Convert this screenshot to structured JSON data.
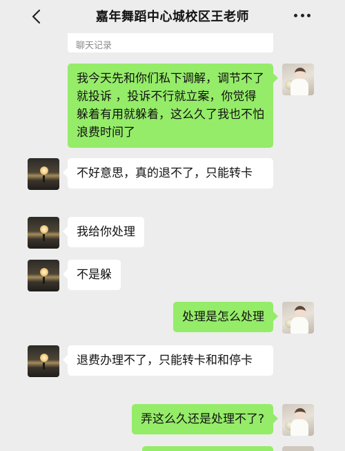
{
  "header": {
    "title": "嘉年舞蹈中心城校区王老师",
    "back_icon": "chevron-left-icon",
    "more_icon": "more-dots-icon"
  },
  "history_label": "聊天记录",
  "messages": [
    {
      "side": "out",
      "text": "我今天先和你们私下调解，调节不了就投诉 ，投诉不行就立案，你觉得躲着有用就躲着，这么久了我也不怕浪费时间了"
    },
    {
      "side": "in",
      "text": "不好意思，真的退不了，只能转卡"
    },
    {
      "side": "in",
      "text": "我给你处理"
    },
    {
      "side": "in",
      "text": "不是躲"
    },
    {
      "side": "out",
      "text": "处理是怎么处理"
    },
    {
      "side": "in",
      "text": "退费办理不了，只能转卡和和停卡"
    },
    {
      "side": "out",
      "text": "弄这么久还是处理不了?"
    }
  ],
  "colors": {
    "background": "#ededed",
    "outgoing_bubble": "#95ec69",
    "incoming_bubble": "#ffffff"
  }
}
